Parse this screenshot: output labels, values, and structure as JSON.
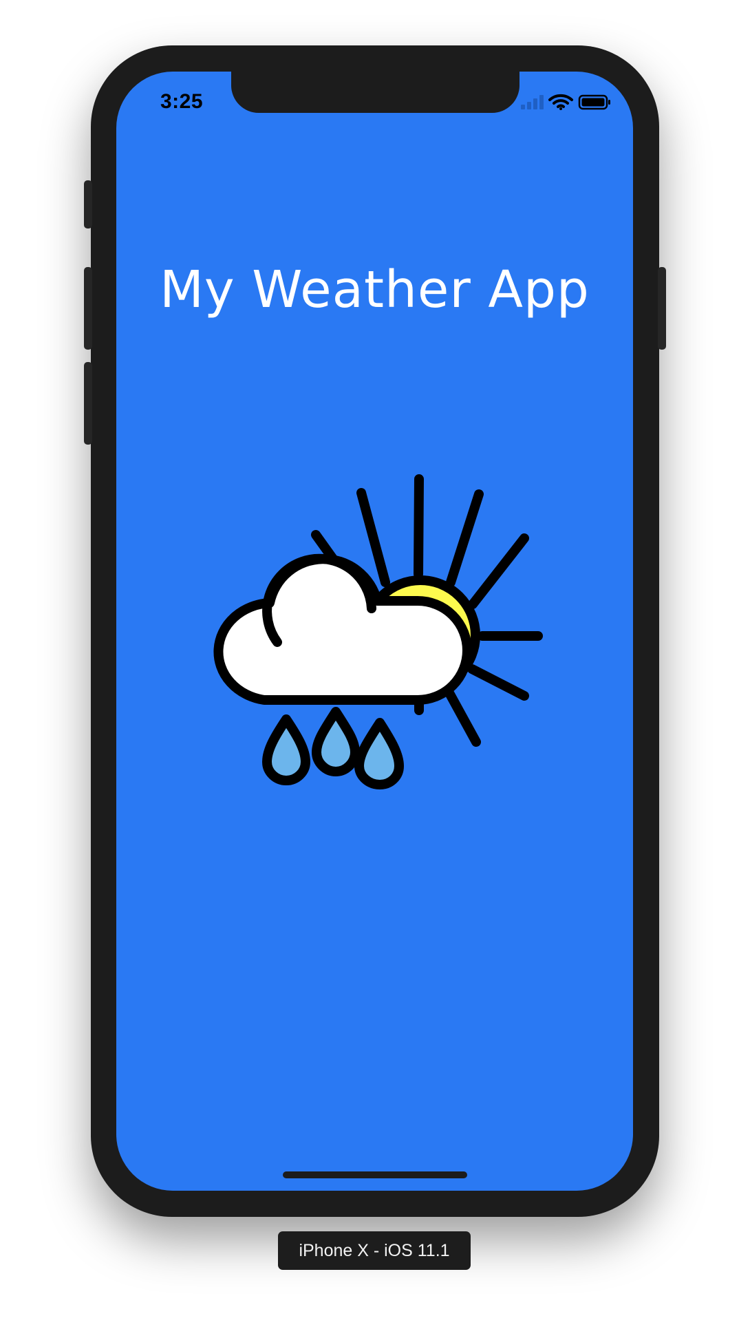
{
  "status_bar": {
    "time": "3:25",
    "icons": [
      "cellular-signal-icon",
      "wifi-icon",
      "battery-icon"
    ]
  },
  "app": {
    "title": "My Weather App",
    "illustration": "sun-cloud-rain-icon",
    "background_color": "#2a79f3"
  },
  "device_label": "iPhone X - iOS 11.1",
  "colors": {
    "sun": "#fdfa4e",
    "cloud": "#ffffff",
    "raindrop": "#6cb5ec",
    "outline": "#000000",
    "bezel": "#1c1c1c"
  }
}
